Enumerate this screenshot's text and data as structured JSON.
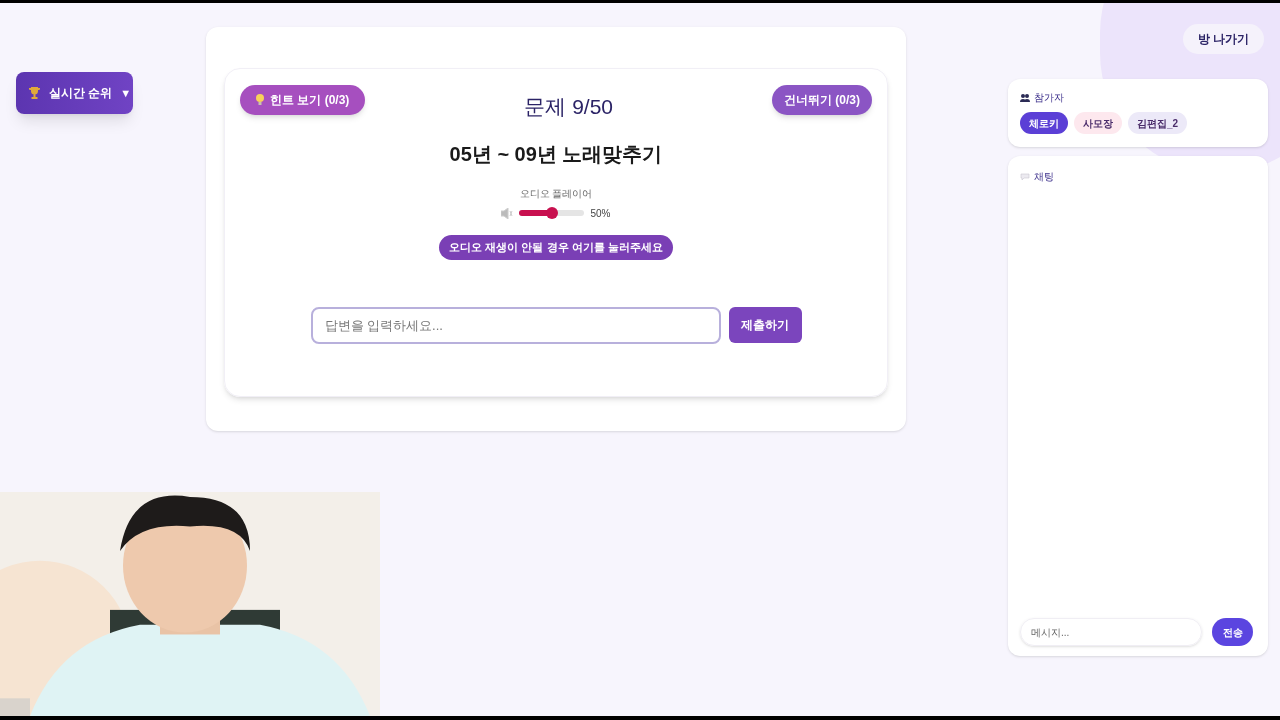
{
  "ranking_button": {
    "label": "실시간 순위",
    "caret": "▼"
  },
  "quiz": {
    "hint_button": "힌트 보기 (0/3)",
    "progress": "문제 9/50",
    "skip_button": "건너뛰기 (0/3)",
    "title": "05년 ~ 09년 노래맞추기",
    "audio": {
      "label": "오디오 플레이어",
      "volume": {
        "level": 0.5,
        "reading": "50%"
      },
      "fallback_button": "오디오 재생이 안될 경우 여기를 눌러주세요"
    },
    "answer": {
      "placeholder": "답변을 입력하세요...",
      "submit": "제출하기"
    }
  },
  "leave_button": "방 나가기",
  "participants": {
    "title": "참가자",
    "items": [
      {
        "name": "체로키",
        "selected": true,
        "color": "#5b3fd6"
      },
      {
        "name": "사모장",
        "selected": false,
        "color": "#fde8ee"
      },
      {
        "name": "김편집_2",
        "selected": false,
        "color": "#ece9f8"
      }
    ]
  },
  "chat": {
    "title": "채팅",
    "placeholder": "메시지...",
    "send": "전송"
  }
}
